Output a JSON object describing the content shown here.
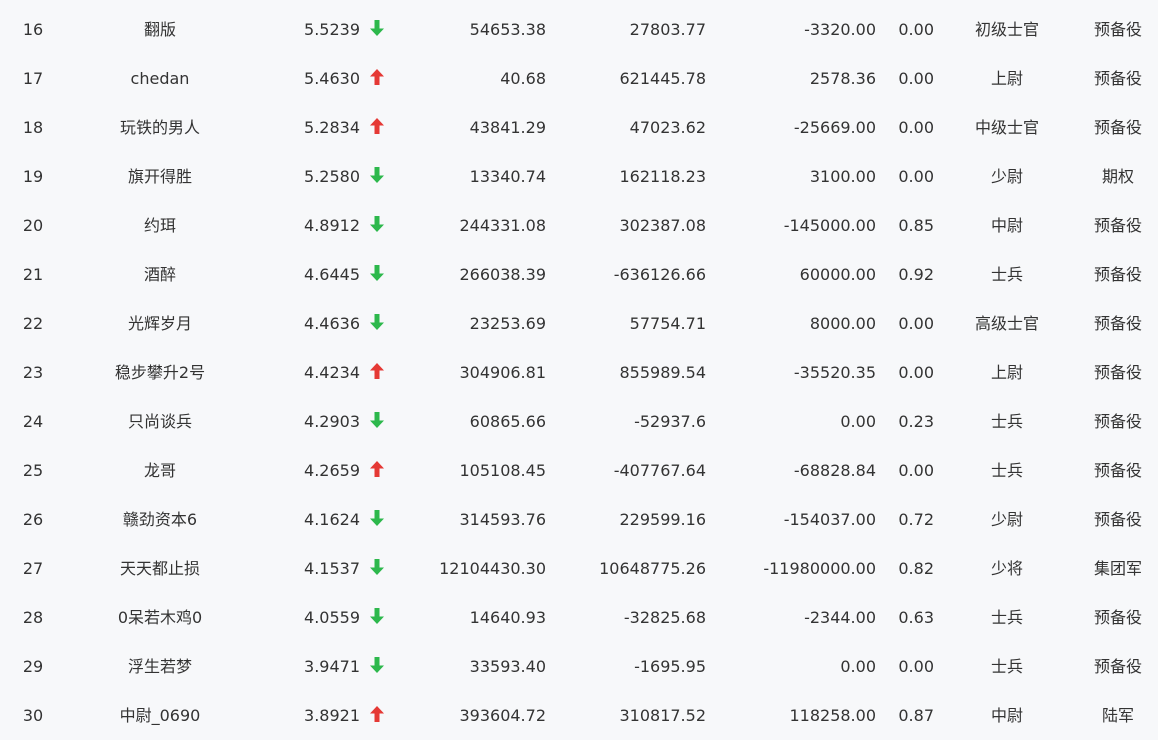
{
  "colors": {
    "background": "#f7f8fa",
    "text": "#333333",
    "arrow_up": "#e53935",
    "arrow_down": "#2db84c"
  },
  "rows": [
    {
      "rank": "16",
      "name": "翻版",
      "score": "5.5239",
      "trend": "down",
      "trend_icon": "arrow-down-icon",
      "v1": "54653.38",
      "v2": "27803.77",
      "v3": "-3320.00",
      "ratio": "0.00",
      "rank_title": "初级士官",
      "unit": "预备役"
    },
    {
      "rank": "17",
      "name": "chedan",
      "score": "5.4630",
      "trend": "up",
      "trend_icon": "arrow-up-icon",
      "v1": "40.68",
      "v2": "621445.78",
      "v3": "2578.36",
      "ratio": "0.00",
      "rank_title": "上尉",
      "unit": "预备役"
    },
    {
      "rank": "18",
      "name": "玩铁的男人",
      "score": "5.2834",
      "trend": "up",
      "trend_icon": "arrow-up-icon",
      "v1": "43841.29",
      "v2": "47023.62",
      "v3": "-25669.00",
      "ratio": "0.00",
      "rank_title": "中级士官",
      "unit": "预备役"
    },
    {
      "rank": "19",
      "name": "旗开得胜",
      "score": "5.2580",
      "trend": "down",
      "trend_icon": "arrow-down-icon",
      "v1": "13340.74",
      "v2": "162118.23",
      "v3": "3100.00",
      "ratio": "0.00",
      "rank_title": "少尉",
      "unit": "期权"
    },
    {
      "rank": "20",
      "name": "约珥",
      "score": "4.8912",
      "trend": "down",
      "trend_icon": "arrow-down-icon",
      "v1": "244331.08",
      "v2": "302387.08",
      "v3": "-145000.00",
      "ratio": "0.85",
      "rank_title": "中尉",
      "unit": "预备役"
    },
    {
      "rank": "21",
      "name": "酒醉",
      "score": "4.6445",
      "trend": "down",
      "trend_icon": "arrow-down-icon",
      "v1": "266038.39",
      "v2": "-636126.66",
      "v3": "60000.00",
      "ratio": "0.92",
      "rank_title": "士兵",
      "unit": "预备役"
    },
    {
      "rank": "22",
      "name": "光辉岁月",
      "score": "4.4636",
      "trend": "down",
      "trend_icon": "arrow-down-icon",
      "v1": "23253.69",
      "v2": "57754.71",
      "v3": "8000.00",
      "ratio": "0.00",
      "rank_title": "高级士官",
      "unit": "预备役"
    },
    {
      "rank": "23",
      "name": "稳步攀升2号",
      "score": "4.4234",
      "trend": "up",
      "trend_icon": "arrow-up-icon",
      "v1": "304906.81",
      "v2": "855989.54",
      "v3": "-35520.35",
      "ratio": "0.00",
      "rank_title": "上尉",
      "unit": "预备役"
    },
    {
      "rank": "24",
      "name": "只尚谈兵",
      "score": "4.2903",
      "trend": "down",
      "trend_icon": "arrow-down-icon",
      "v1": "60865.66",
      "v2": "-52937.6",
      "v3": "0.00",
      "ratio": "0.23",
      "rank_title": "士兵",
      "unit": "预备役"
    },
    {
      "rank": "25",
      "name": "龙哥",
      "score": "4.2659",
      "trend": "up",
      "trend_icon": "arrow-up-icon",
      "v1": "105108.45",
      "v2": "-407767.64",
      "v3": "-68828.84",
      "ratio": "0.00",
      "rank_title": "士兵",
      "unit": "预备役"
    },
    {
      "rank": "26",
      "name": "赣劲资本6",
      "score": "4.1624",
      "trend": "down",
      "trend_icon": "arrow-down-icon",
      "v1": "314593.76",
      "v2": "229599.16",
      "v3": "-154037.00",
      "ratio": "0.72",
      "rank_title": "少尉",
      "unit": "预备役"
    },
    {
      "rank": "27",
      "name": "天天都止损",
      "score": "4.1537",
      "trend": "down",
      "trend_icon": "arrow-down-icon",
      "v1": "12104430.30",
      "v2": "10648775.26",
      "v3": "-11980000.00",
      "ratio": "0.82",
      "rank_title": "少将",
      "unit": "集团军"
    },
    {
      "rank": "28",
      "name": "0呆若木鸡0",
      "score": "4.0559",
      "trend": "down",
      "trend_icon": "arrow-down-icon",
      "v1": "14640.93",
      "v2": "-32825.68",
      "v3": "-2344.00",
      "ratio": "0.63",
      "rank_title": "士兵",
      "unit": "预备役"
    },
    {
      "rank": "29",
      "name": "浮生若梦",
      "score": "3.9471",
      "trend": "down",
      "trend_icon": "arrow-down-icon",
      "v1": "33593.40",
      "v2": "-1695.95",
      "v3": "0.00",
      "ratio": "0.00",
      "rank_title": "士兵",
      "unit": "预备役"
    },
    {
      "rank": "30",
      "name": "中尉_0690",
      "score": "3.8921",
      "trend": "up",
      "trend_icon": "arrow-up-icon",
      "v1": "393604.72",
      "v2": "310817.52",
      "v3": "118258.00",
      "ratio": "0.87",
      "rank_title": "中尉",
      "unit": "陆军"
    }
  ]
}
